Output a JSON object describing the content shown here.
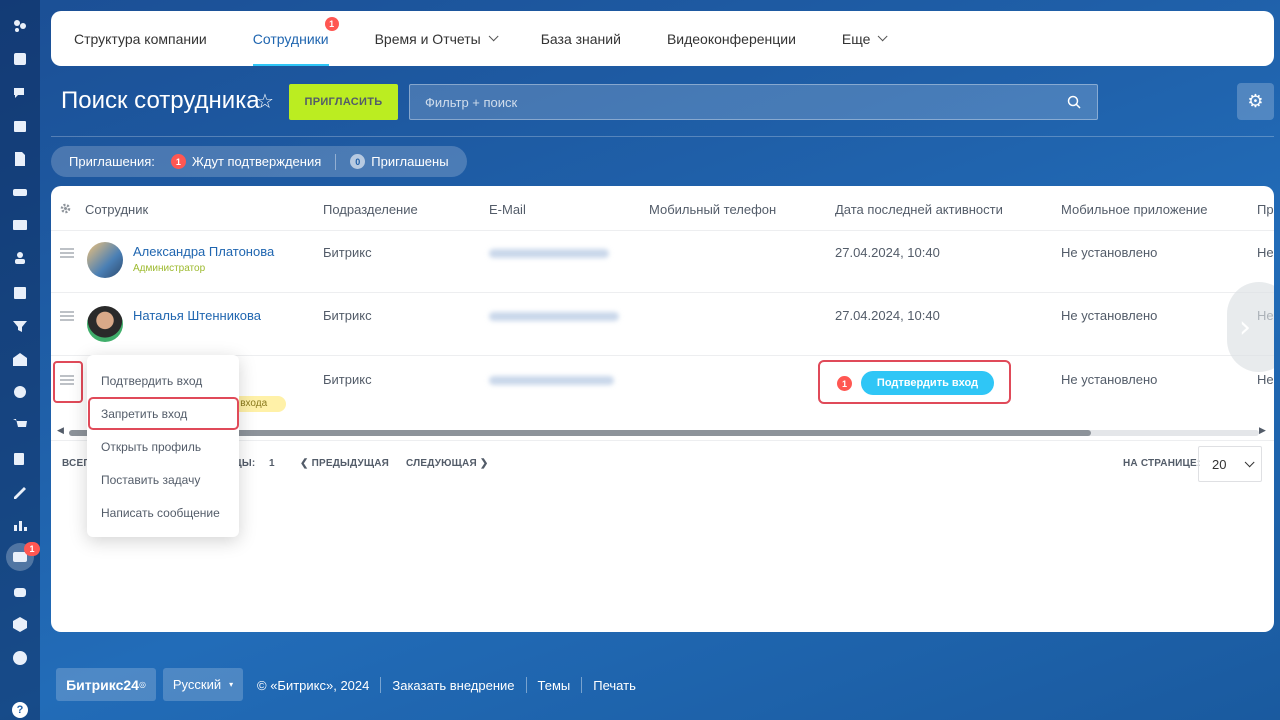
{
  "nav": {
    "items": [
      {
        "label": "Структура компании"
      },
      {
        "label": "Сотрудники",
        "badge": "1"
      },
      {
        "label": "Время и Отчеты"
      },
      {
        "label": "База знаний"
      },
      {
        "label": "Видеоконференции"
      },
      {
        "label": "Еще"
      }
    ]
  },
  "rail": {
    "badge": "1",
    "icons": [
      "stream-icon",
      "news-icon",
      "chat-icon",
      "calendar-icon",
      "docs-icon",
      "drive-icon",
      "mail-icon",
      "groups-icon",
      "tasks-icon",
      "crm-filter-icon",
      "company-icon",
      "target-icon",
      "shop-icon",
      "edit-icon",
      "sign-icon",
      "analytics-icon",
      "employees-icon",
      "robot-icon",
      "market-icon",
      "more-icon"
    ]
  },
  "page": {
    "title": "Поиск сотрудника",
    "invite_label": "ПРИГЛАСИТЬ",
    "search_placeholder": "Фильтр + поиск"
  },
  "invitations": {
    "label": "Приглашения:",
    "pending_count": "1",
    "pending_label": "Ждут подтверждения",
    "invited_count": "0",
    "invited_label": "Приглашены"
  },
  "table": {
    "columns": [
      "Сотрудник",
      "Подразделение",
      "E-Mail",
      "Мобильный телефон",
      "Дата последней активности",
      "Мобильное приложение",
      "Пр"
    ],
    "rows": [
      {
        "name": "Александра Платонова",
        "role": "Администратор",
        "department": "Битрикс",
        "last_activity": "27.04.2024, 10:40",
        "mobile_app": "Не установлено",
        "extra": "Не"
      },
      {
        "name": "Наталья Штенникова",
        "role": "",
        "department": "Битрикс",
        "last_activity": "27.04.2024, 10:40",
        "mobile_app": "Не установлено",
        "extra": "Не"
      },
      {
        "name": "",
        "role": "",
        "department": "Битрикс",
        "last_activity": "",
        "mobile_app": "Не установлено",
        "extra": "Не",
        "pending_badge": "я входа",
        "confirm_count": "1",
        "confirm_label": "Подтвердить вход"
      }
    ]
  },
  "context_menu": {
    "items": [
      "Подтвердить вход",
      "Запретить вход",
      "Открыть профиль",
      "Поставить задачу",
      "Написать сообщение"
    ]
  },
  "pager": {
    "total_prefix": "ВСЕГО",
    "pages_suffix": "ИЦЫ:",
    "pages_value": "1",
    "prev_label": "ПРЕДЫДУЩАЯ",
    "next_label": "СЛЕДУЮЩАЯ",
    "per_page_label": "НА СТРАНИЦЕ:",
    "per_page_value": "20"
  },
  "footer": {
    "logo": "Битрикс24",
    "language": "Русский",
    "copyright": "© «Битрикс», 2024",
    "links": [
      "Заказать внедрение",
      "Темы",
      "Печать"
    ]
  },
  "colors": {
    "accent": "#2fc6f6",
    "invite_button": "#bbed21",
    "badge": "#ff5752",
    "highlight": "#e04a59",
    "link": "#2066b0"
  }
}
